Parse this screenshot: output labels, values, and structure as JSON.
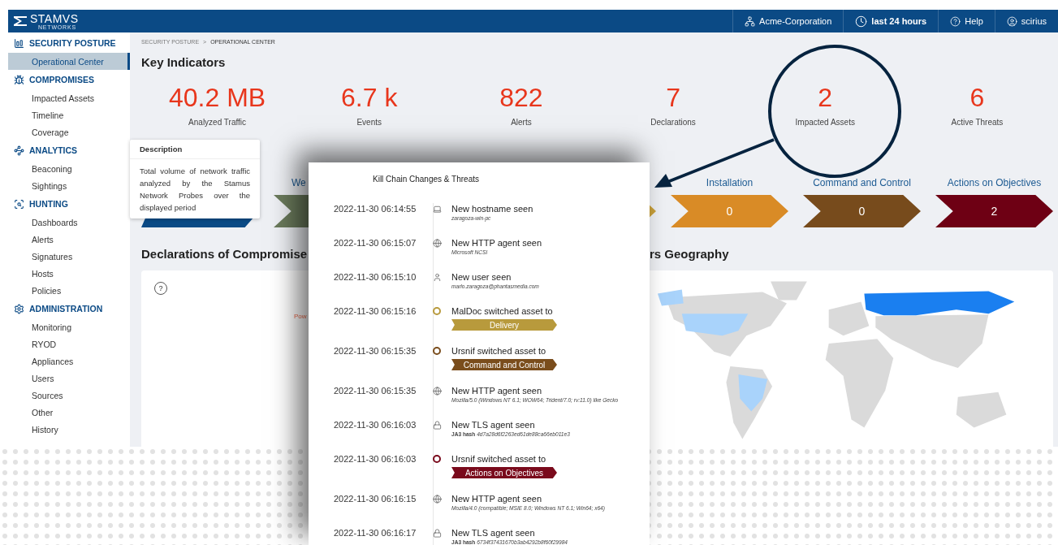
{
  "brand": {
    "name": "STAMVS",
    "tagline": "NETWORKS"
  },
  "top_bar": [
    {
      "kind": "tenant",
      "label": "Acme-Corporation"
    },
    {
      "kind": "period",
      "label": "last 24 hours"
    },
    {
      "kind": "help",
      "label": "Help"
    },
    {
      "kind": "user",
      "label": "scirius"
    }
  ],
  "sidebar": [
    {
      "kind": "posture",
      "title": "SECURITY POSTURE",
      "items": [
        {
          "label": "Operational Center",
          "selected": true
        }
      ]
    },
    {
      "kind": "compromises",
      "title": "COMPROMISES",
      "items": [
        {
          "label": "Impacted Assets",
          "selected": false
        },
        {
          "label": "Timeline",
          "selected": false
        },
        {
          "label": "Coverage",
          "selected": false
        }
      ]
    },
    {
      "kind": "analytics",
      "title": "ANALYTICS",
      "items": [
        {
          "label": "Beaconing",
          "selected": false
        },
        {
          "label": "Sightings",
          "selected": false
        }
      ]
    },
    {
      "kind": "hunting",
      "title": "HUNTING",
      "items": [
        {
          "label": "Dashboards",
          "selected": false
        },
        {
          "label": "Alerts",
          "selected": false
        },
        {
          "label": "Signatures",
          "selected": false
        },
        {
          "label": "Hosts",
          "selected": false
        },
        {
          "label": "Policies",
          "selected": false
        }
      ]
    },
    {
      "kind": "administration",
      "title": "ADMINISTRATION",
      "items": [
        {
          "label": "Monitoring",
          "selected": false
        },
        {
          "label": "RYOD",
          "selected": false
        },
        {
          "label": "Appliances",
          "selected": false
        },
        {
          "label": "Users",
          "selected": false
        },
        {
          "label": "Sources",
          "selected": false
        },
        {
          "label": "Other",
          "selected": false
        },
        {
          "label": "History",
          "selected": false
        }
      ]
    }
  ],
  "breadcrumb": {
    "parent": "SECURITY POSTURE",
    "separator": ">",
    "current": "OPERATIONAL CENTER"
  },
  "key_indicators": {
    "title": "Key Indicators",
    "items": [
      {
        "value": "40.2 MB",
        "label": "Analyzed Traffic"
      },
      {
        "value": "6.7 k",
        "label": "Events"
      },
      {
        "value": "822",
        "label": "Alerts"
      },
      {
        "value": "7",
        "label": "Declarations"
      },
      {
        "value": "2",
        "label": "Impacted Assets"
      },
      {
        "value": "6",
        "label": "Active Threats"
      }
    ]
  },
  "tooltip": {
    "title": "Description",
    "text": "Total volume of network traffic analyzed by the Stamus Network Probes over the displayed period"
  },
  "kill_chain": [
    {
      "color": "#0a4a85"
    },
    {
      "label": "We",
      "color": "#6b7b5c"
    },
    {
      "color": "#c9a03a"
    },
    {
      "label": "Installation",
      "value": "0",
      "color": "#d98b26"
    },
    {
      "label": "Command and Control",
      "value": "0",
      "color": "#774b1c"
    },
    {
      "label": "Actions on Objectives",
      "value": "2",
      "color": "#6e0014"
    }
  ],
  "declarations": {
    "title": "Declarations of Compromise",
    "help": "?",
    "note": "Pow"
  },
  "geography": {
    "title": "rs Geography"
  },
  "popup": {
    "title": "Kill Chain Changes & Threats",
    "events": [
      {
        "time": "2022-11-30 06:14:55",
        "kind": "hostname",
        "title": "New hostname seen",
        "detail": "zaragoza-win-pc"
      },
      {
        "time": "2022-11-30 06:15:07",
        "kind": "http",
        "title": "New HTTP agent seen",
        "detail": "Microsoft NCSI"
      },
      {
        "time": "2022-11-30 06:15:10",
        "kind": "user",
        "title": "New user seen",
        "detail": "marlo.zaragoza@phantasmedia.com"
      },
      {
        "time": "2022-11-30 06:15:16",
        "kind": "stage",
        "title": "MalDoc switched asset to",
        "stage": "Delivery",
        "color": "#b89a3c"
      },
      {
        "time": "2022-11-30 06:15:35",
        "kind": "stage",
        "title": "Ursnif switched asset to",
        "stage": "Command and Control",
        "color": "#7a4d1c"
      },
      {
        "time": "2022-11-30 06:15:35",
        "kind": "http",
        "title": "New HTTP agent seen",
        "detail": "Mozilla/5.0 (Windows NT 6.1; WOW64; Trident/7.0; rv:11.0) like Gecko"
      },
      {
        "time": "2022-11-30 06:16:03",
        "kind": "tls",
        "title": "New TLS agent seen",
        "detail": "**JA3 hash** 4d7a28d6f2263ed61de88ca66eb011e3"
      },
      {
        "time": "2022-11-30 06:16:03",
        "kind": "stage",
        "title": "Ursnif switched asset to",
        "stage": "Actions on Objectives",
        "color": "#7a0a1c"
      },
      {
        "time": "2022-11-30 06:16:15",
        "kind": "http",
        "title": "New HTTP agent seen",
        "detail": "Mozilla/4.0 (compatible; MSIE 8.0; Windows NT 6.1; Win64; x64)"
      },
      {
        "time": "2022-11-30 06:16:17",
        "kind": "tls",
        "title": "New TLS agent seen",
        "detail": "**JA3 hash** 6734f37431670b3ab4292b8f60f29984"
      }
    ]
  }
}
